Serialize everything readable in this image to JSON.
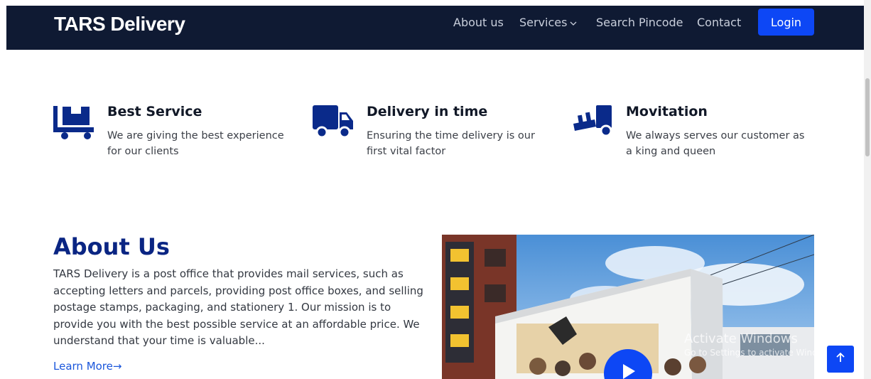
{
  "header": {
    "brand": "TARS Delivery",
    "nav": {
      "about": "About us",
      "services": "Services",
      "search_pincode": "Search Pincode",
      "contact": "Contact"
    },
    "login_label": "Login"
  },
  "features": [
    {
      "title": "Best Service",
      "text": "We are giving the best experience for our clients",
      "icon": "hand-truck-icon"
    },
    {
      "title": "Delivery in time",
      "text": "Ensuring the time delivery is our first vital factor",
      "icon": "truck-icon"
    },
    {
      "title": "Movitation",
      "text": "We always serves our customer as a king and queen",
      "icon": "dolly-icon"
    }
  ],
  "about": {
    "title": "About Us",
    "text": "TARS Delivery is a post office that provides mail services, such as accepting letters and parcels, providing post office boxes, and selling postage stamps, packaging, and stationery 1. Our mission is to provide you with the best possible service at an affordable price. We understand that your time is valuable...",
    "learn_more": "Learn More→"
  },
  "watermark": {
    "line1": "Activate Windows",
    "line2": "Go to Settings to activate Windows."
  },
  "colors": {
    "navbar": "#0f1a33",
    "accent": "#0d47f5",
    "heading_blue": "#0a2583",
    "icon_blue": "#0a2a8a"
  }
}
